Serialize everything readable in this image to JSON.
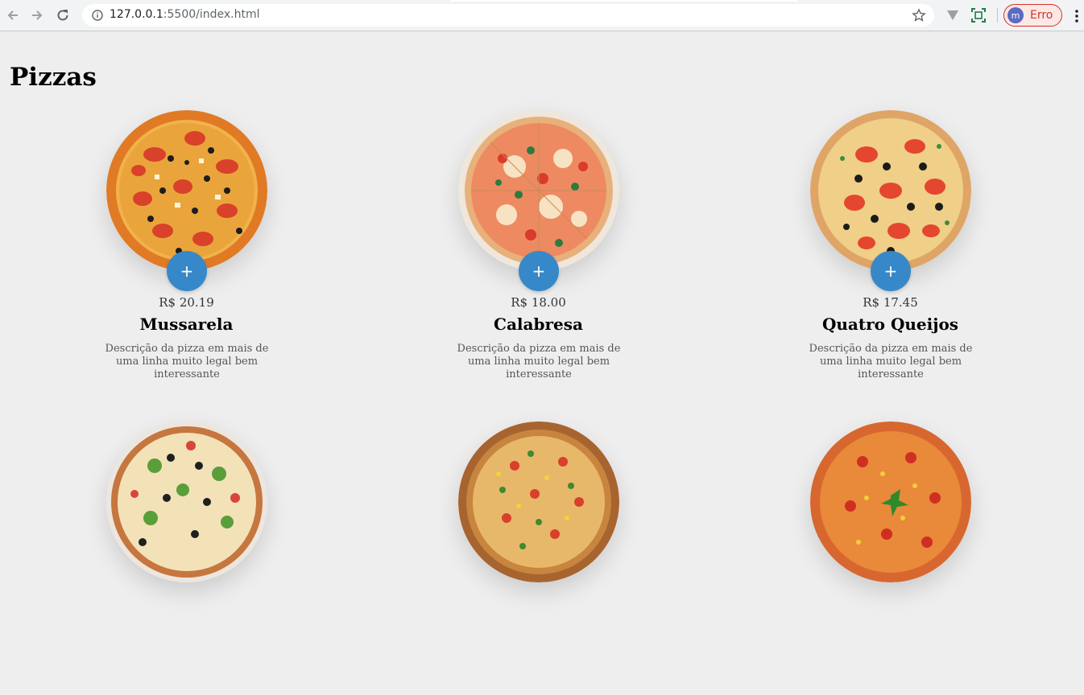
{
  "browser": {
    "url_host": "127.0.0.1",
    "url_path": ":5500/index.html",
    "profile_initial": "m",
    "profile_label": "Erro"
  },
  "page": {
    "title": "Pizzas"
  },
  "pizzas": [
    {
      "price": "R$ 20.19",
      "name": "Mussarela",
      "description": "Descrição da pizza em mais de uma linha muito legal bem interessante",
      "add_label": "+"
    },
    {
      "price": "R$ 18.00",
      "name": "Calabresa",
      "description": "Descrição da pizza em mais de uma linha muito legal bem interessante",
      "add_label": "+"
    },
    {
      "price": "R$ 17.45",
      "name": "Quatro Queijos",
      "description": "Descrição da pizza em mais de uma linha muito legal bem interessante",
      "add_label": "+"
    },
    {
      "price": "",
      "name": "",
      "description": "",
      "add_label": ""
    },
    {
      "price": "",
      "name": "",
      "description": "",
      "add_label": ""
    },
    {
      "price": "",
      "name": "",
      "description": "",
      "add_label": ""
    }
  ],
  "colors": {
    "accent": "#3788c8",
    "background": "#eeeeee",
    "error": "#d93025"
  }
}
